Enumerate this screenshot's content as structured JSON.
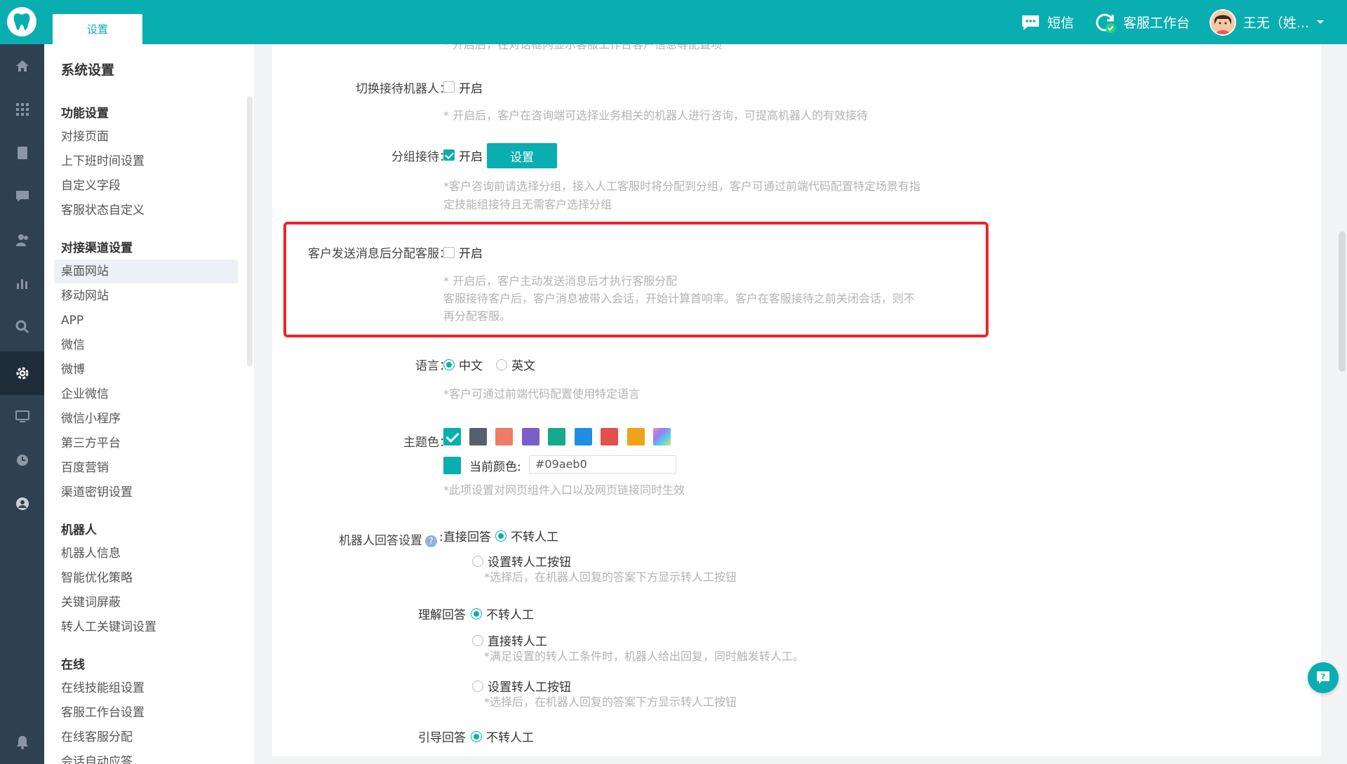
{
  "topbar": {
    "tab_label": "设置",
    "sms_label": "短信",
    "workbench_label": "客服工作台",
    "user_name": "王无（姓..."
  },
  "sidebar": {
    "title": "系统设置",
    "groups": [
      {
        "title": "功能设置",
        "items": [
          "对接页面",
          "上下班时间设置",
          "自定义字段",
          "客服状态自定义"
        ]
      },
      {
        "title": "对接渠道设置",
        "items": [
          "桌面网站",
          "移动网站",
          "APP",
          "微信",
          "微博",
          "企业微信",
          "微信小程序",
          "第三方平台",
          "百度营销",
          "渠道密钥设置"
        ]
      },
      {
        "title": "机器人",
        "items": [
          "机器人信息",
          "智能优化策略",
          "关键词屏蔽",
          "转人工关键词设置"
        ]
      },
      {
        "title": "在线",
        "items": [
          "在线技能组设置",
          "客服工作台设置",
          "在线客服分配",
          "会话自动应答"
        ]
      }
    ],
    "active_item": "桌面网站"
  },
  "main": {
    "top_cut_text": "* 开启后，在对话框内显示客服工作台客户信息等配置项",
    "switch_robot": {
      "label": "切换接待机器人：",
      "option": "开启",
      "hint": "* 开启后，客户在咨询端可选择业务相关的机器人进行咨询，可提高机器人的有效接待"
    },
    "group_reception": {
      "label": "分组接待：",
      "option": "开启",
      "button": "设置",
      "hint_line1": "*客户咨询前请选择分组，接入人工客服时将分配到分组，客户可通过前端代码配置特定场景有指",
      "hint_line2": "定技能组接待且无需客户选择分组"
    },
    "assign_after_message": {
      "label": "客户发送消息后分配客服：",
      "option": "开启",
      "hint_line1": "* 开启后，客户主动发送消息后才执行客服分配",
      "hint_line2": "客服接待客户后，客户消息被带入会话，开始计算首响率。客户在客服接待之前关闭会话，则不",
      "hint_line3": "再分配客服。"
    },
    "language": {
      "label": "语言：",
      "option_cn": "中文",
      "option_en": "英文",
      "hint": "*客户可通过前端代码配置使用特定语言"
    },
    "theme": {
      "label": "主题色：",
      "colors": [
        "#09aeb0",
        "#55606e",
        "#ef7b64",
        "#7b5fc8",
        "#16a98b",
        "#1e8fe1",
        "#e2504b",
        "#f0a21a",
        "gradient"
      ],
      "current_label": "当前颜色:",
      "current_value": "#09aeb0",
      "hint": "*此项设置对网页组件入口以及网页链接同时生效"
    },
    "robot_reply": {
      "label": "机器人回答设置",
      "help": "?",
      "direct": {
        "label": "直接回答",
        "opt1": "不转人工",
        "opt2": "设置转人工按钮",
        "opt2_hint": "*选择后，在机器人回复的答案下方显示转人工按钮"
      },
      "understand": {
        "label": "理解回答",
        "opt1": "不转人工",
        "opt2": "直接转人工",
        "opt2_hint": "*满足设置的转人工条件时，机器人给出回复，同时触发转人工。",
        "opt3": "设置转人工按钮",
        "opt3_hint": "*选择后，在机器人回复的答案下方显示转人工按钮"
      },
      "guide": {
        "label": "引导回答",
        "opt1": "不转人工"
      }
    }
  }
}
